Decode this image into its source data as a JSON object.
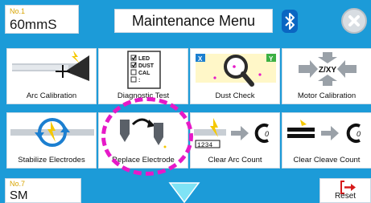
{
  "header": {
    "program_no": "No.1",
    "program_value": "60mmS",
    "title": "Maintenance Menu"
  },
  "tiles": [
    {
      "label": "Arc Calibration",
      "icon": "arc-calibration-icon"
    },
    {
      "label": "Diagnostic Test",
      "icon": "diagnostic-checklist-icon",
      "checklist": [
        "LED",
        "DUST",
        "CAL",
        ":"
      ]
    },
    {
      "label": "Dust Check",
      "icon": "magnifier-icon",
      "corner_left": "X",
      "corner_right": "Y"
    },
    {
      "label": "Motor Calibration",
      "icon": "zxy-arrows-icon",
      "axis_text": "Z/XY"
    },
    {
      "label": "Stabilize Electrodes",
      "icon": "stabilize-electrodes-icon"
    },
    {
      "label": "Replace Electrode",
      "icon": "replace-electrode-icon"
    },
    {
      "label": "Clear Arc Count",
      "icon": "clear-arc-count-icon",
      "counter": "1234",
      "reset_glyph": "0"
    },
    {
      "label": "Clear Cleave Count",
      "icon": "clear-cleave-count-icon",
      "reset_glyph": "0"
    }
  ],
  "footer": {
    "program_no": "No.7",
    "program_value": "SM",
    "reset_label": "Reset"
  },
  "colors": {
    "background": "#1c9bd8",
    "accent_yellow": "#f5c800",
    "highlight": "#e619c8",
    "arrow_gray": "#9aa1a8"
  }
}
